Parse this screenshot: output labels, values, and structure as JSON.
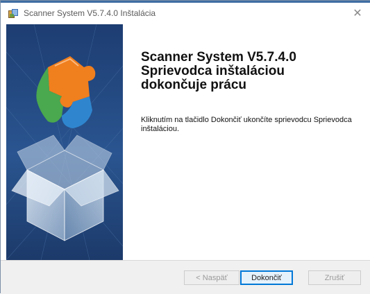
{
  "window": {
    "title": "Scanner System V5.7.4.0 Inštalácia",
    "close_glyph": "✕"
  },
  "main": {
    "heading_lines": [
      "Scanner System V5.7.4.0",
      "Sprievodca inštaláciou",
      "dokončuje prácu"
    ],
    "description": "Kliknutím na tlačidlo Dokončiť ukončíte sprievodcu Sprievodca inštaláciou."
  },
  "buttons": {
    "back": "< Naspäť",
    "finish": "Dokončiť",
    "cancel": "Zrušiť"
  },
  "colors": {
    "banner_bg": "#233f73",
    "puzzle_orange": "#f07f1e",
    "puzzle_green": "#4aa84e",
    "puzzle_blue": "#2f86cf",
    "focus_border": "#0078d7"
  },
  "icons": {
    "title_icon": "installer-package-icon",
    "banner_art": "puzzle-box-illustration"
  }
}
